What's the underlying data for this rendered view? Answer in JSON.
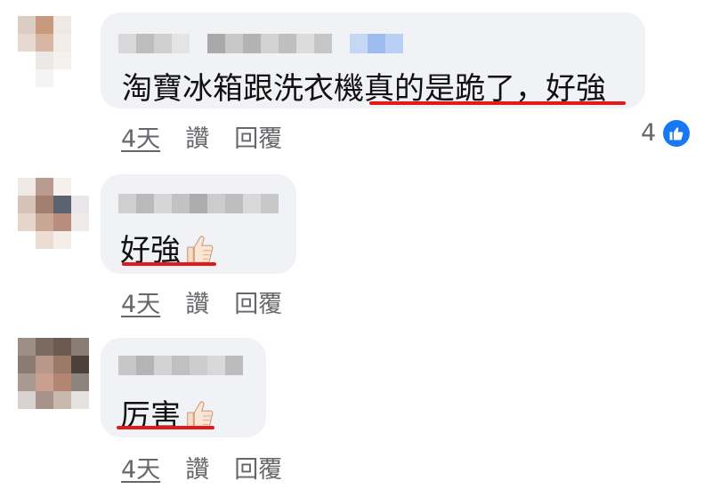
{
  "comments": [
    {
      "text": "淘寶冰箱跟洗衣機真的是跪了，好強",
      "time": "4天",
      "like_label": "讚",
      "reply_label": "回覆",
      "reaction_count": "4",
      "reaction_icon": "like-icon"
    },
    {
      "text": "好強",
      "emoji": "thumbs-up-icon",
      "time": "4天",
      "like_label": "讚",
      "reply_label": "回覆"
    },
    {
      "text": "厉害",
      "emoji": "thumbs-up-icon",
      "time": "4天",
      "like_label": "讚",
      "reply_label": "回覆"
    }
  ],
  "colors": {
    "bubble": "#f0f2f5",
    "highlight_underline": "#e01b1b",
    "like_badge": "#1877f2",
    "action_text": "#65676b"
  }
}
